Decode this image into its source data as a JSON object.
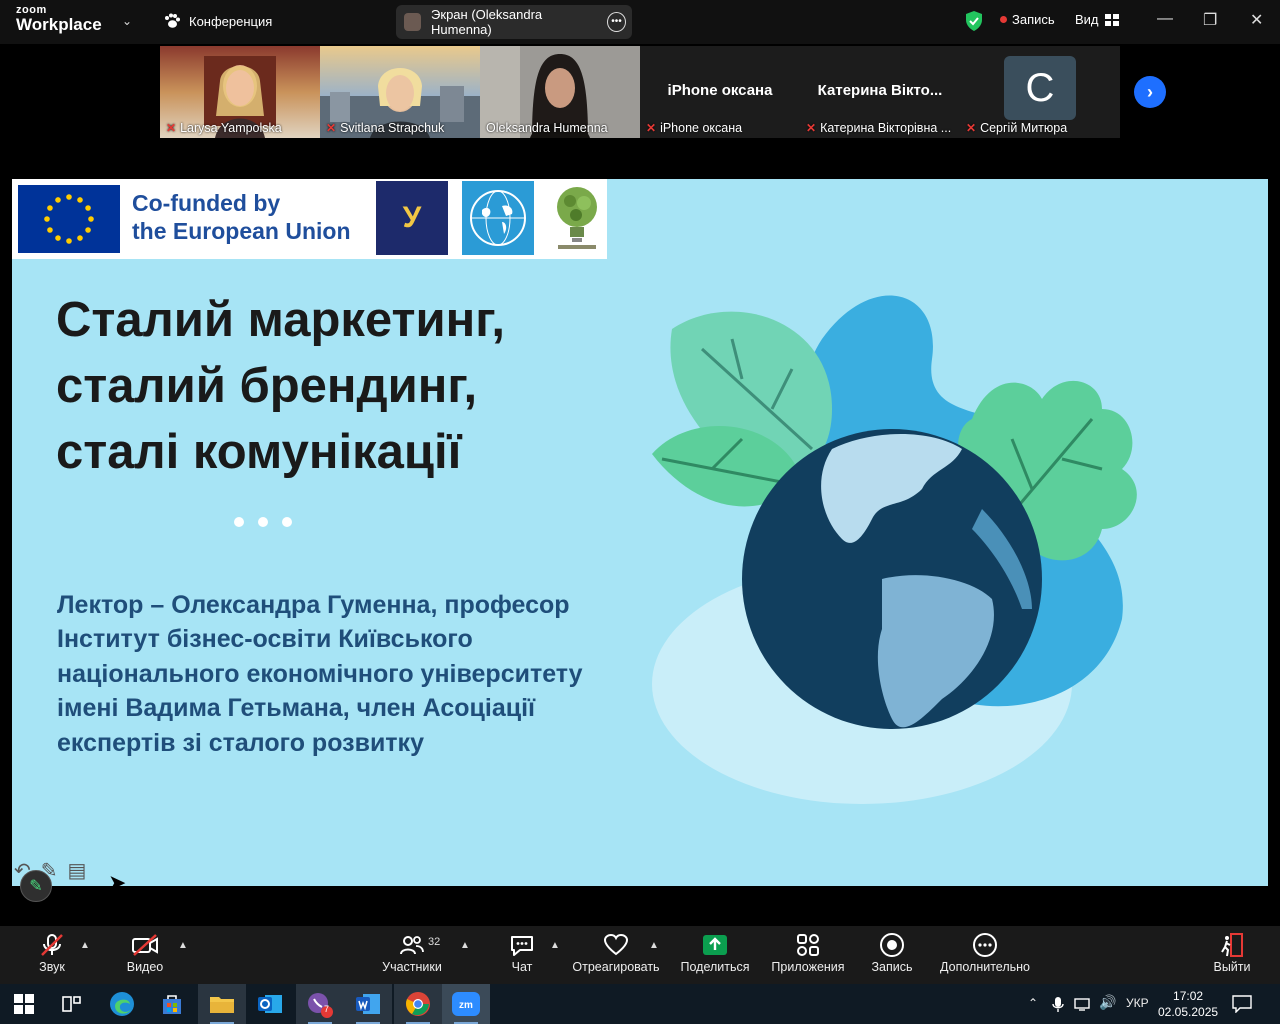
{
  "titlebar": {
    "logo_line1": "zoom",
    "logo_line2": "Workplace",
    "conference_label": "Конференция",
    "share_label": "Экран (Oleksandra Humenna)",
    "record_label": "Запись",
    "view_label": "Вид"
  },
  "participants": [
    {
      "name": "Larysa Yampolska",
      "muted": true
    },
    {
      "name": "Svitlana Strapchuk",
      "muted": true
    },
    {
      "name": "Oleksandra Humenna",
      "muted": false,
      "active": true
    },
    {
      "name": "iPhone оксана",
      "center": "iPhone оксана",
      "muted": true
    },
    {
      "name": "Катерина Вікторівна ...",
      "center": "Катерина Вікто...",
      "muted": true
    },
    {
      "name": "Сергій Митюра",
      "initial": "С",
      "muted": true
    }
  ],
  "slide": {
    "eu_line1": "Co-funded by",
    "eu_line2": "the European Union",
    "logo_u_letter": "У",
    "title_line1": "Сталий маркетинг,",
    "title_line2": "сталий брендинг,",
    "title_line3": "сталі комунікації",
    "lecturer": "Лектор – Олександра Гуменна, професор Інститут бізнес-освіти Київського національного економічного університету імені Вадима Гетьмана, член Асоціації експертів зі сталого розвитку",
    "bg_color": "#a7e4f5"
  },
  "toolbar": {
    "audio": "Звук",
    "video": "Видео",
    "participants": "Участники",
    "participants_count": "32",
    "chat": "Чат",
    "react": "Отреагировать",
    "share": "Поделиться",
    "apps": "Приложения",
    "record": "Запись",
    "more": "Дополнительно",
    "leave": "Выйти"
  },
  "taskbar": {
    "viber_badge": "7",
    "lang": "УКР",
    "time": "17:02",
    "date": "02.05.2025"
  },
  "colors": {
    "accent_green": "#22c55e",
    "zoom_blue": "#1e6fff",
    "share_green": "#0b9e4f",
    "leave_red": "#e53935"
  }
}
